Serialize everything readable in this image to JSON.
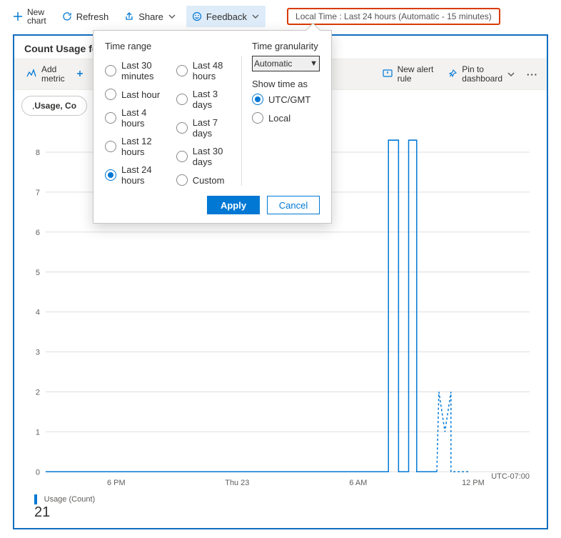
{
  "toolbar": {
    "new_chart_label": "New\nchart",
    "refresh_label": "Refresh",
    "share_label": "Share",
    "feedback_label": "Feedback",
    "time_pill": "Local Time : Last 24 hours (Automatic - 15 minutes)"
  },
  "card": {
    "title": "Count Usage for",
    "add_metric_label": "Add\nmetric",
    "new_alert_rule_label": "New alert\nrule",
    "pin_dashboard_label": "Pin to\ndashboard",
    "chip_prefix": ", ",
    "chip_bold": "Usage, Co"
  },
  "popover": {
    "time_range_title": "Time range",
    "granularity_title": "Time granularity",
    "granularity_value": "Automatic",
    "show_time_as_title": "Show time as",
    "apply_label": "Apply",
    "cancel_label": "Cancel",
    "ranges_col1": [
      {
        "label": "Last 30 minutes",
        "selected": false
      },
      {
        "label": "Last hour",
        "selected": false
      },
      {
        "label": "Last 4 hours",
        "selected": false
      },
      {
        "label": "Last 12 hours",
        "selected": false
      },
      {
        "label": "Last 24 hours",
        "selected": true
      }
    ],
    "ranges_col2": [
      {
        "label": "Last 48 hours",
        "selected": false
      },
      {
        "label": "Last 3 days",
        "selected": false
      },
      {
        "label": "Last 7 days",
        "selected": false
      },
      {
        "label": "Last 30 days",
        "selected": false
      },
      {
        "label": "Custom",
        "selected": false
      }
    ],
    "show_time_options": [
      {
        "label": "UTC/GMT",
        "selected": true
      },
      {
        "label": "Local",
        "selected": false
      }
    ]
  },
  "chart_data": {
    "type": "line",
    "title": "",
    "ylabel": "",
    "ylim": [
      0,
      8.3
    ],
    "y_ticks": [
      0,
      1,
      2,
      3,
      4,
      5,
      6,
      7,
      8
    ],
    "x_ticks": [
      "6 PM",
      "Thu 23",
      "6 AM",
      "12 PM"
    ],
    "x_domain_hours": 24,
    "timezone_label": "UTC-07:00",
    "legend_name": "Usage (Count)",
    "legend_value": "21",
    "series": [
      {
        "name": "Usage (Count)",
        "style": "solid",
        "points": [
          [
            0,
            0
          ],
          [
            17,
            0
          ],
          [
            17,
            8.6
          ],
          [
            17.5,
            8.6
          ],
          [
            17.5,
            0
          ],
          [
            18.0,
            0
          ],
          [
            18.0,
            8.6
          ],
          [
            18.4,
            8.6
          ],
          [
            18.4,
            0
          ],
          [
            19.4,
            0
          ]
        ]
      },
      {
        "name": "Usage (Count) projected",
        "style": "dash",
        "points": [
          [
            19.4,
            0
          ],
          [
            19.5,
            2
          ],
          [
            19.8,
            1
          ],
          [
            20.1,
            2
          ],
          [
            20.1,
            0
          ],
          [
            21,
            0
          ]
        ]
      }
    ]
  },
  "colors": {
    "accent": "#0078d4",
    "highlight_border": "#d83b01",
    "grid": "#e1dfdd"
  }
}
